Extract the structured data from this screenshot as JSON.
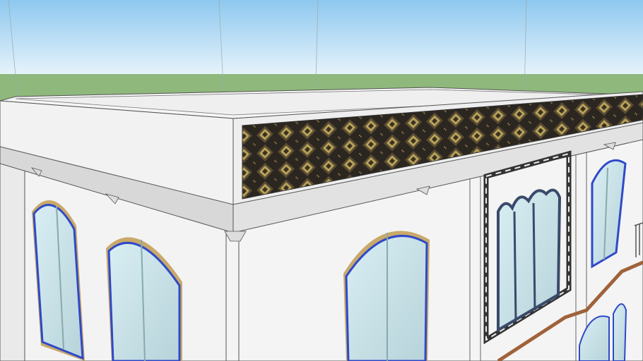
{
  "scene": {
    "sky_top": "#8ec8ef",
    "sky_bottom": "#e6f3fb",
    "ground": "#8fb87c",
    "wall": "#f3f3f3",
    "wall_shade": "#e4e4e4",
    "glass": "#c9e3ea",
    "window_frame": "#2f49c8",
    "arch_trim": "#c9a96a",
    "band_dark": "#2b2620",
    "band_gold": "#b9a45a",
    "ledge": "#a0623a"
  }
}
